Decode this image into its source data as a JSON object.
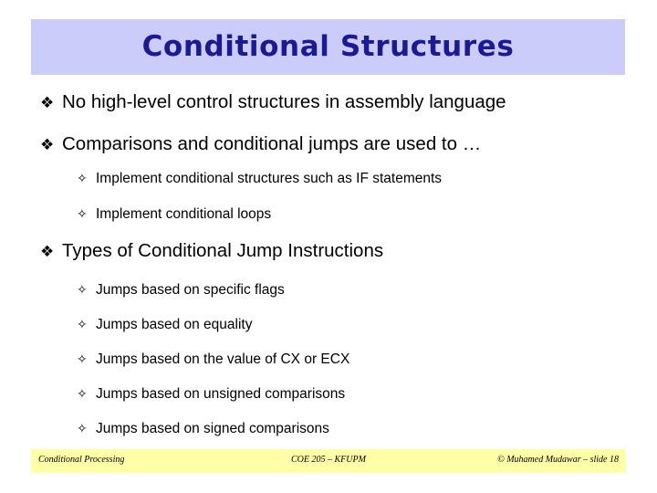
{
  "slide": {
    "title": "Conditional Structures",
    "title_bg_color": "#ccccfa",
    "title_text_color": "#1a1a96",
    "background_color": "#ffffff"
  },
  "bullets": [
    {
      "level": 1,
      "marker": "❖",
      "text": "No high-level control structures in assembly language"
    },
    {
      "level": 1,
      "marker": "❖",
      "text": "Comparisons and conditional jumps are used to …"
    },
    {
      "level": 2,
      "marker": "✧",
      "text": "Implement conditional structures such as IF statements"
    },
    {
      "level": 2,
      "marker": "✧",
      "text": "Implement conditional loops"
    },
    {
      "level": 1,
      "marker": "❖",
      "text": "Types of Conditional Jump Instructions"
    },
    {
      "level": 2,
      "marker": "✧",
      "text": "Jumps based on specific flags"
    },
    {
      "level": 2,
      "marker": "✧",
      "text": "Jumps based on equality"
    },
    {
      "level": 2,
      "marker": "✧",
      "text": "Jumps based on the value of CX or ECX"
    },
    {
      "level": 2,
      "marker": "✧",
      "text": "Jumps based on unsigned comparisons"
    },
    {
      "level": 2,
      "marker": "✧",
      "text": "Jumps based on signed comparisons"
    }
  ],
  "footer": {
    "bg_color": "#ffffa8",
    "left": "Conditional Processing",
    "center": "COE 205 – KFUPM",
    "right": "© Muhamed Mudawar – slide 18"
  }
}
